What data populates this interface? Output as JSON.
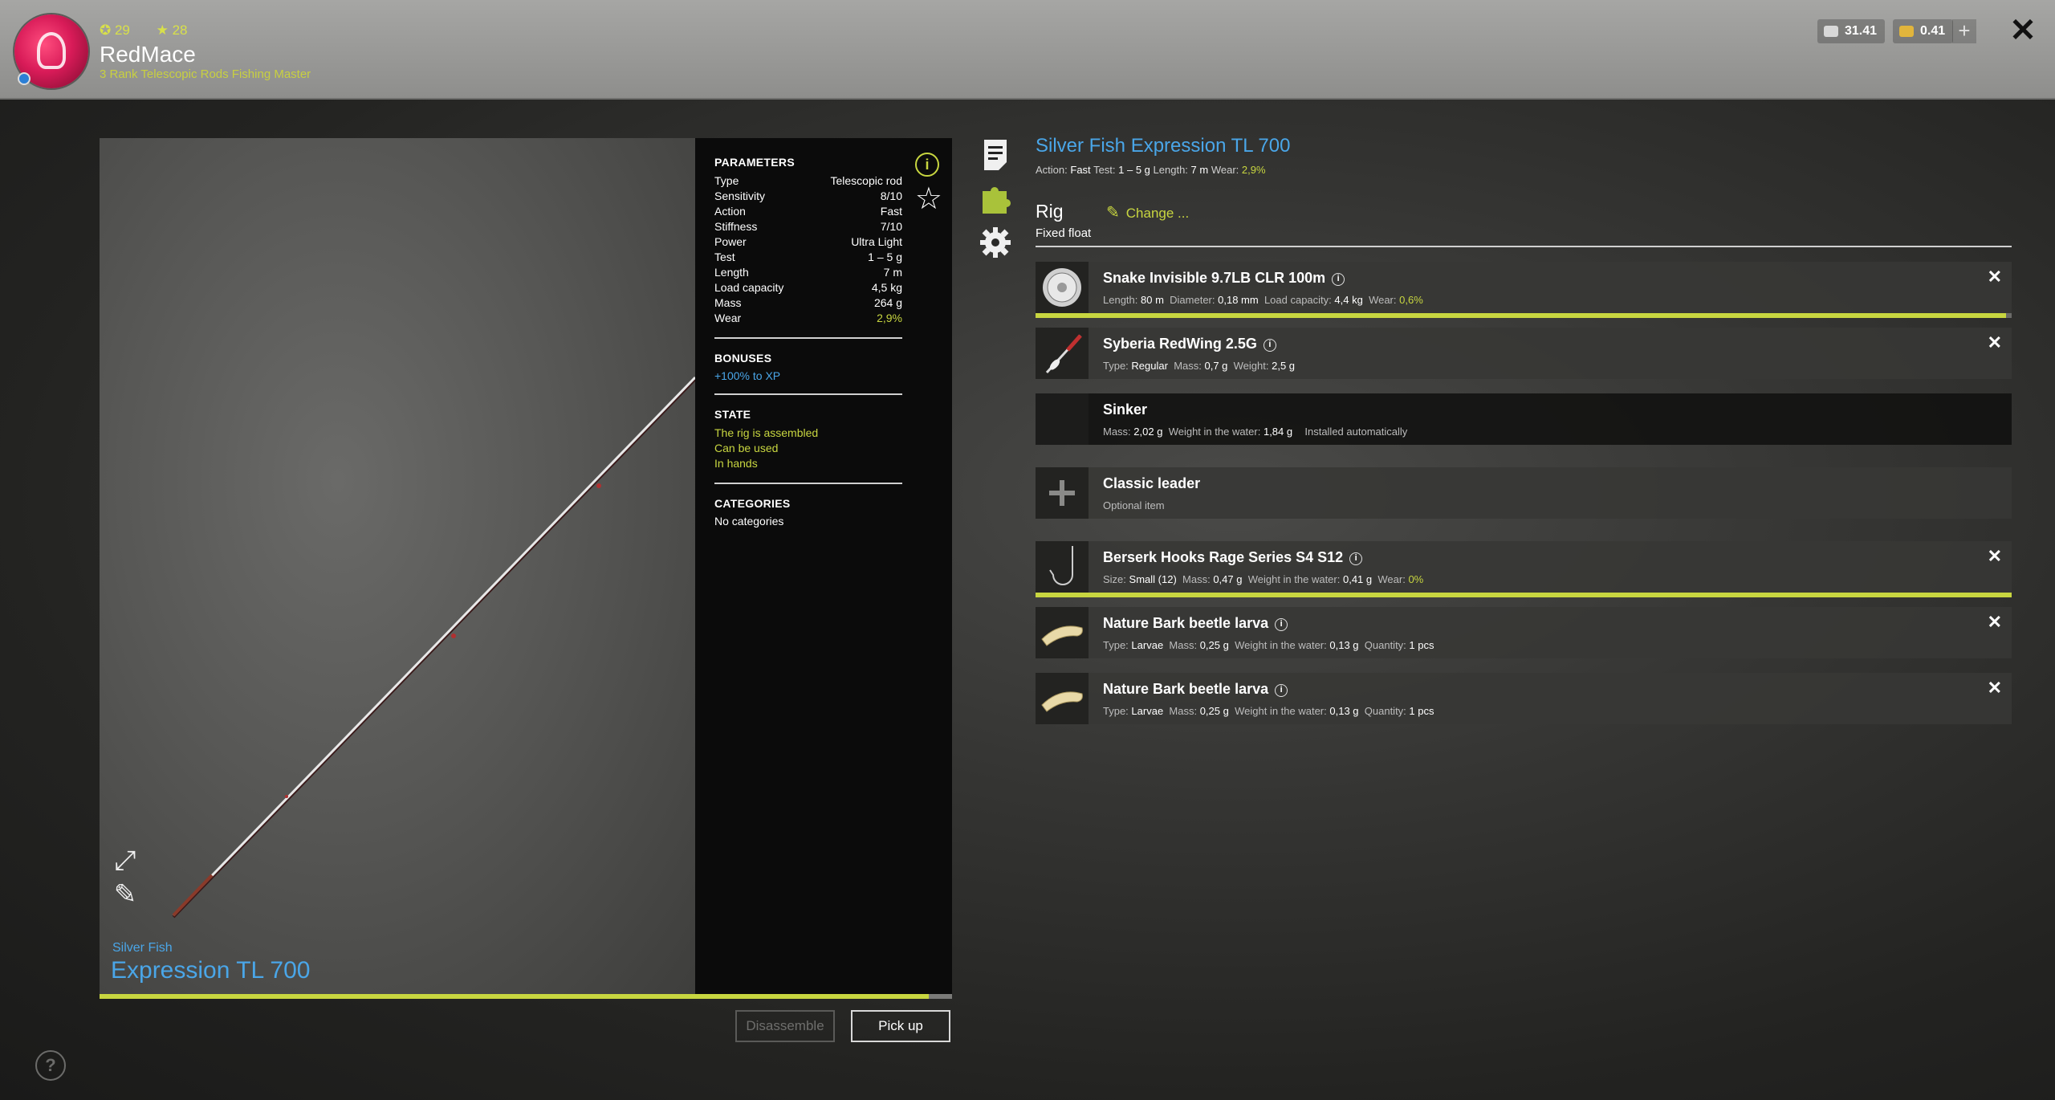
{
  "player": {
    "stat_level": "29",
    "stat_rank": "28",
    "name": "RedMace",
    "rank_title": "3 Rank Telescopic Rods Fishing Master"
  },
  "currency": {
    "silver": "31.41",
    "gold": "0.41",
    "add_label": "+"
  },
  "preview": {
    "brand": "Silver Fish",
    "model": "Expression TL 700",
    "wear_fraction": 0.973
  },
  "parameters": {
    "title": "PARAMETERS",
    "rows": [
      {
        "label": "Type",
        "value": "Telescopic rod"
      },
      {
        "label": "Sensitivity",
        "value": "8/10"
      },
      {
        "label": "Action",
        "value": "Fast"
      },
      {
        "label": "Stiffness",
        "value": "7/10"
      },
      {
        "label": "Power",
        "value": "Ultra Light"
      },
      {
        "label": "Test",
        "value": "1 – 5 g"
      },
      {
        "label": "Length",
        "value": "7 m"
      },
      {
        "label": "Load capacity",
        "value": "4,5 kg"
      },
      {
        "label": "Mass",
        "value": "264 g"
      },
      {
        "label": "Wear",
        "value": "2,9%"
      }
    ],
    "bonuses_title": "BONUSES",
    "bonus": "+100% to XP",
    "state_title": "STATE",
    "states": [
      "The rig is assembled",
      "Can be used",
      "In hands"
    ],
    "categories_title": "CATEGORIES",
    "categories": "No categories"
  },
  "buttons": {
    "disassemble": "Disassemble",
    "pickup": "Pick up"
  },
  "rod": {
    "title": "Silver Fish Expression TL 700",
    "action_label": "Action:",
    "action": "Fast",
    "test_label": "Test:",
    "test": "1 – 5 g",
    "length_label": "Length:",
    "length": "7 m",
    "wear_label": "Wear:",
    "wear": "2,9%"
  },
  "rig": {
    "title": "Rig",
    "change_label": "Change ...",
    "type": "Fixed float"
  },
  "items": [
    {
      "name": "Snake Invisible 9.7LB CLR 100m",
      "props": [
        [
          "Length:",
          "80 m"
        ],
        [
          "Diameter:",
          "0,18 mm"
        ],
        [
          "Load capacity:",
          "4,4 kg"
        ],
        [
          "Wear:",
          "0,6%"
        ]
      ],
      "wear_fraction": 0.994
    },
    {
      "name": "Syberia RedWing 2.5G",
      "props": [
        [
          "Type:",
          "Regular"
        ],
        [
          "Mass:",
          "0,7 g"
        ],
        [
          "Weight:",
          "2,5 g"
        ]
      ]
    },
    {
      "name": "Sinker",
      "props": [
        [
          "Mass:",
          "2,02 g"
        ],
        [
          "Weight in the water:",
          "1,84 g"
        ]
      ],
      "note": "Installed automatically"
    },
    {
      "name": "Classic leader",
      "note": "Optional item"
    },
    {
      "name": "Berserk Hooks Rage Series S4 S12",
      "props": [
        [
          "Size:",
          "Small (12)"
        ],
        [
          "Mass:",
          "0,47 g"
        ],
        [
          "Weight in the water:",
          "0,41 g"
        ],
        [
          "Wear:",
          "0%"
        ]
      ],
      "wear_fraction": 1.0
    },
    {
      "name": "Nature Bark beetle larva",
      "props": [
        [
          "Type:",
          "Larvae"
        ],
        [
          "Mass:",
          "0,25 g"
        ],
        [
          "Weight in the water:",
          "0,13 g"
        ],
        [
          "Quantity:",
          "1 pcs"
        ]
      ]
    },
    {
      "name": "Nature Bark beetle larva",
      "props": [
        [
          "Type:",
          "Larvae"
        ],
        [
          "Mass:",
          "0,25 g"
        ],
        [
          "Weight in the water:",
          "0,13 g"
        ],
        [
          "Quantity:",
          "1 pcs"
        ]
      ]
    }
  ],
  "colors": {
    "accent": "#c8d640",
    "title_blue": "#4aa6e8"
  },
  "icons": {
    "close": "close-icon",
    "info": "info-icon",
    "star": "star-icon",
    "help": "help-icon"
  }
}
